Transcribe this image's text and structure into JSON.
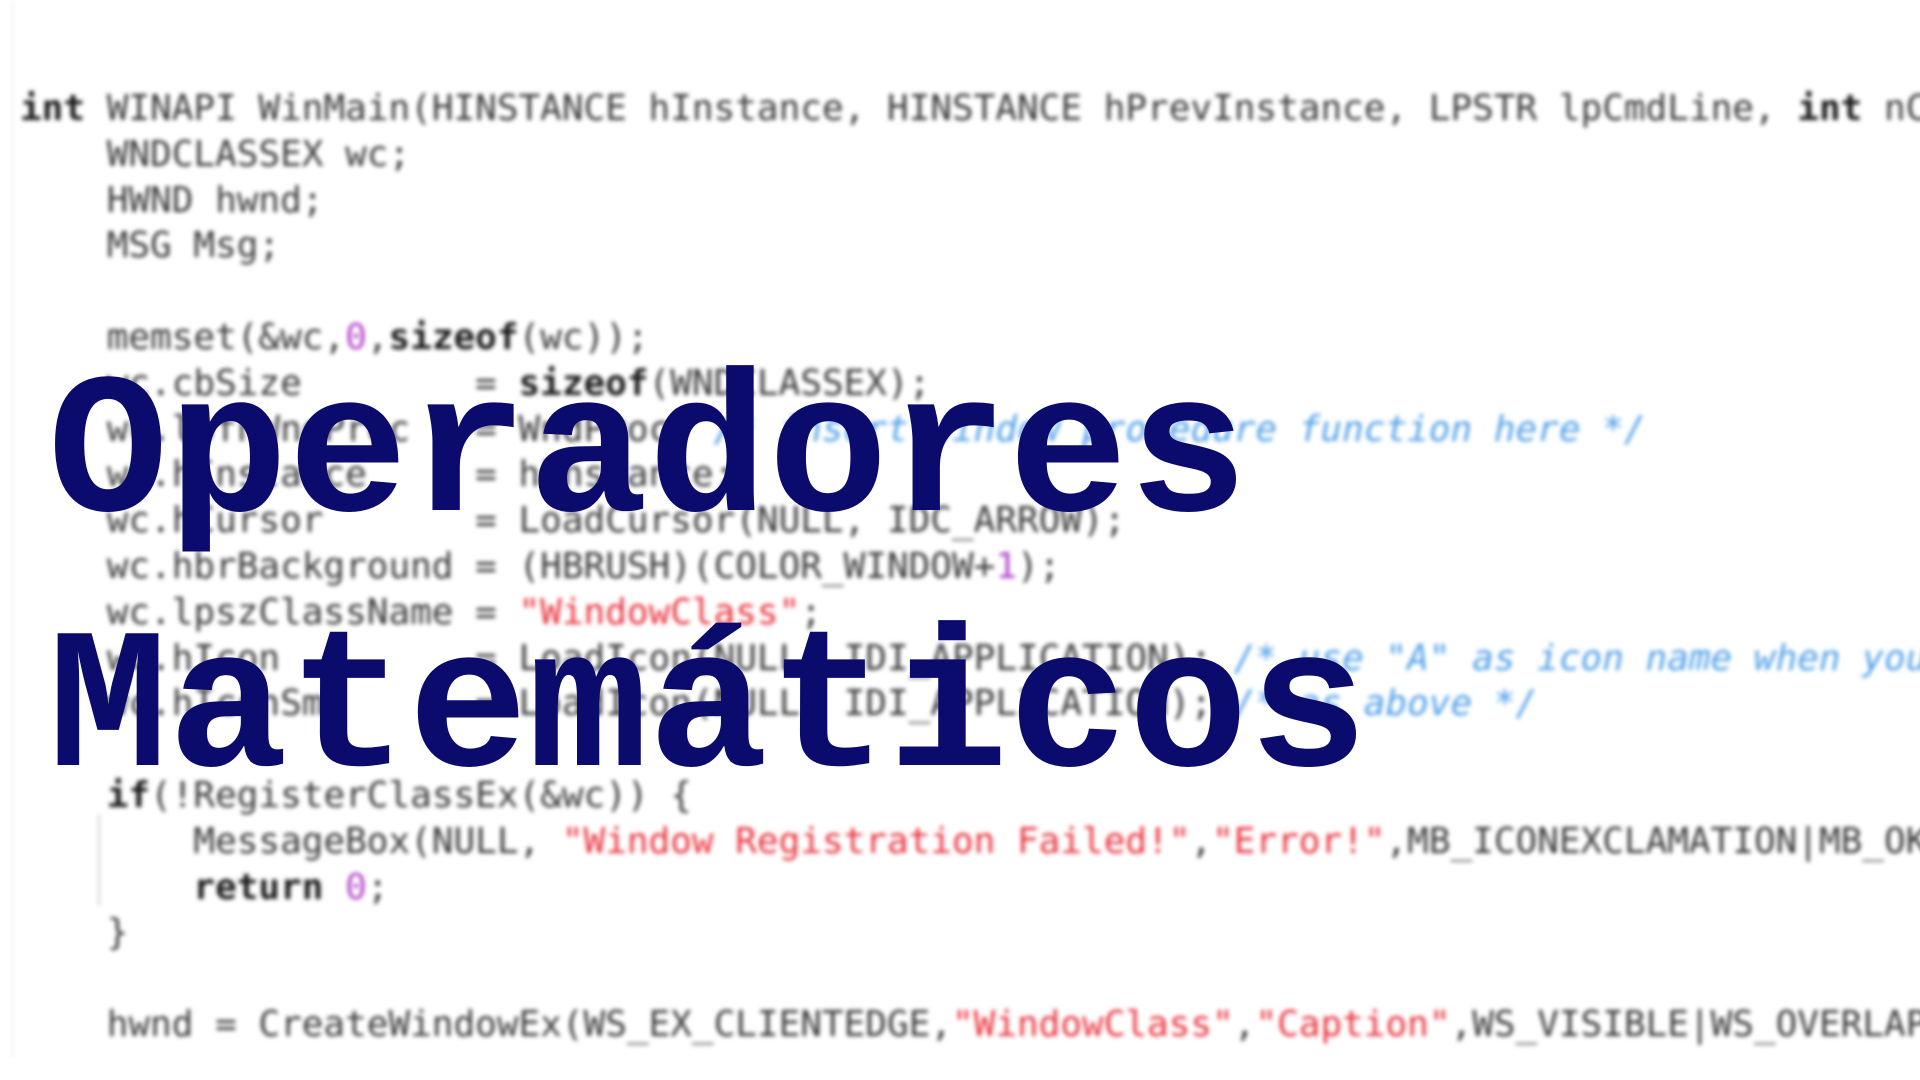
{
  "code": {
    "lines": [
      [
        {
          "t": "int",
          "c": "kw"
        },
        {
          "t": " WINAPI WinMain(HINSTANCE hInstance, HINSTANCE hPrevInstance, LPSTR lpCmdLine, ",
          "c": "txt"
        },
        {
          "t": "int",
          "c": "kw"
        },
        {
          "t": " nCmdShow",
          "c": "txt"
        }
      ],
      [
        {
          "t": "    WNDCLASSEX wc;",
          "c": "txt"
        }
      ],
      [
        {
          "t": "    HWND hwnd;",
          "c": "txt"
        }
      ],
      [
        {
          "t": "    MSG Msg;",
          "c": "txt"
        }
      ],
      [
        {
          "t": "",
          "c": "txt"
        }
      ],
      [
        {
          "t": "    memset(&wc,",
          "c": "txt"
        },
        {
          "t": "0",
          "c": "num"
        },
        {
          "t": ",",
          "c": "txt"
        },
        {
          "t": "sizeof",
          "c": "kw"
        },
        {
          "t": "(wc));",
          "c": "txt"
        }
      ],
      [
        {
          "t": "    wc.cbSize        = ",
          "c": "txt"
        },
        {
          "t": "sizeof",
          "c": "kw"
        },
        {
          "t": "(WNDCLASSEX);",
          "c": "txt"
        }
      ],
      [
        {
          "t": "    wc.lpfnWndProc   = WndProc; ",
          "c": "txt"
        },
        {
          "t": "/* insert window procedure function here */",
          "c": "cmt"
        }
      ],
      [
        {
          "t": "    wc.hInstance     = hInstance;",
          "c": "txt"
        }
      ],
      [
        {
          "t": "    wc.hCursor       = LoadCursor(NULL, IDC_ARROW);",
          "c": "txt"
        }
      ],
      [
        {
          "t": "    wc.hbrBackground = (HBRUSH)(COLOR_WINDOW+",
          "c": "txt"
        },
        {
          "t": "1",
          "c": "num"
        },
        {
          "t": ");",
          "c": "txt"
        }
      ],
      [
        {
          "t": "    wc.lpszClassName = ",
          "c": "txt"
        },
        {
          "t": "\"WindowClass\"",
          "c": "str"
        },
        {
          "t": ";",
          "c": "txt"
        }
      ],
      [
        {
          "t": "    wc.hIcon         = LoadIcon(NULL, IDI_APPLICATION); ",
          "c": "txt"
        },
        {
          "t": "/* use \"A\" as icon name when you want to use the project icon */",
          "c": "cmt"
        }
      ],
      [
        {
          "t": "    wc.hIconSm       = LoadIcon(NULL, IDI_APPLICATION); ",
          "c": "txt"
        },
        {
          "t": "/* as above */",
          "c": "cmt"
        }
      ],
      [
        {
          "t": "",
          "c": "txt"
        }
      ],
      [
        {
          "t": "    ",
          "c": "txt"
        },
        {
          "t": "if",
          "c": "kw"
        },
        {
          "t": "(!RegisterClassEx(&wc)) {",
          "c": "txt"
        }
      ],
      [
        {
          "t": "        MessageBox(NULL, ",
          "c": "txt"
        },
        {
          "t": "\"Window Registration Failed!\"",
          "c": "str"
        },
        {
          "t": ",",
          "c": "txt"
        },
        {
          "t": "\"Error!\"",
          "c": "str"
        },
        {
          "t": ",MB_ICONEXCLAMATION|MB_OK);",
          "c": "txt"
        }
      ],
      [
        {
          "t": "        ",
          "c": "txt"
        },
        {
          "t": "return",
          "c": "kw"
        },
        {
          "t": " ",
          "c": "txt"
        },
        {
          "t": "0",
          "c": "num"
        },
        {
          "t": ";",
          "c": "txt"
        }
      ],
      [
        {
          "t": "    }",
          "c": "txt"
        }
      ],
      [
        {
          "t": "",
          "c": "txt"
        }
      ],
      [
        {
          "t": "    hwnd = CreateWindowEx(WS_EX_CLIENTEDGE,",
          "c": "txt"
        },
        {
          "t": "\"WindowClass\"",
          "c": "str"
        },
        {
          "t": ",",
          "c": "txt"
        },
        {
          "t": "\"Caption\"",
          "c": "str"
        },
        {
          "t": ",WS_VISIBLE|WS_OVERLAPPEDWINDOW,",
          "c": "txt"
        }
      ]
    ]
  },
  "overlay": {
    "line1": "Operadores",
    "line2": "Matemáticos"
  },
  "colors": {
    "title": "#0b0b6e",
    "keyword": "#1a1a1a",
    "string": "#e8323c",
    "number": "#b040c8",
    "comment": "#4f9fe8",
    "code_text": "#3a3a3a",
    "background": "#ffffff"
  }
}
